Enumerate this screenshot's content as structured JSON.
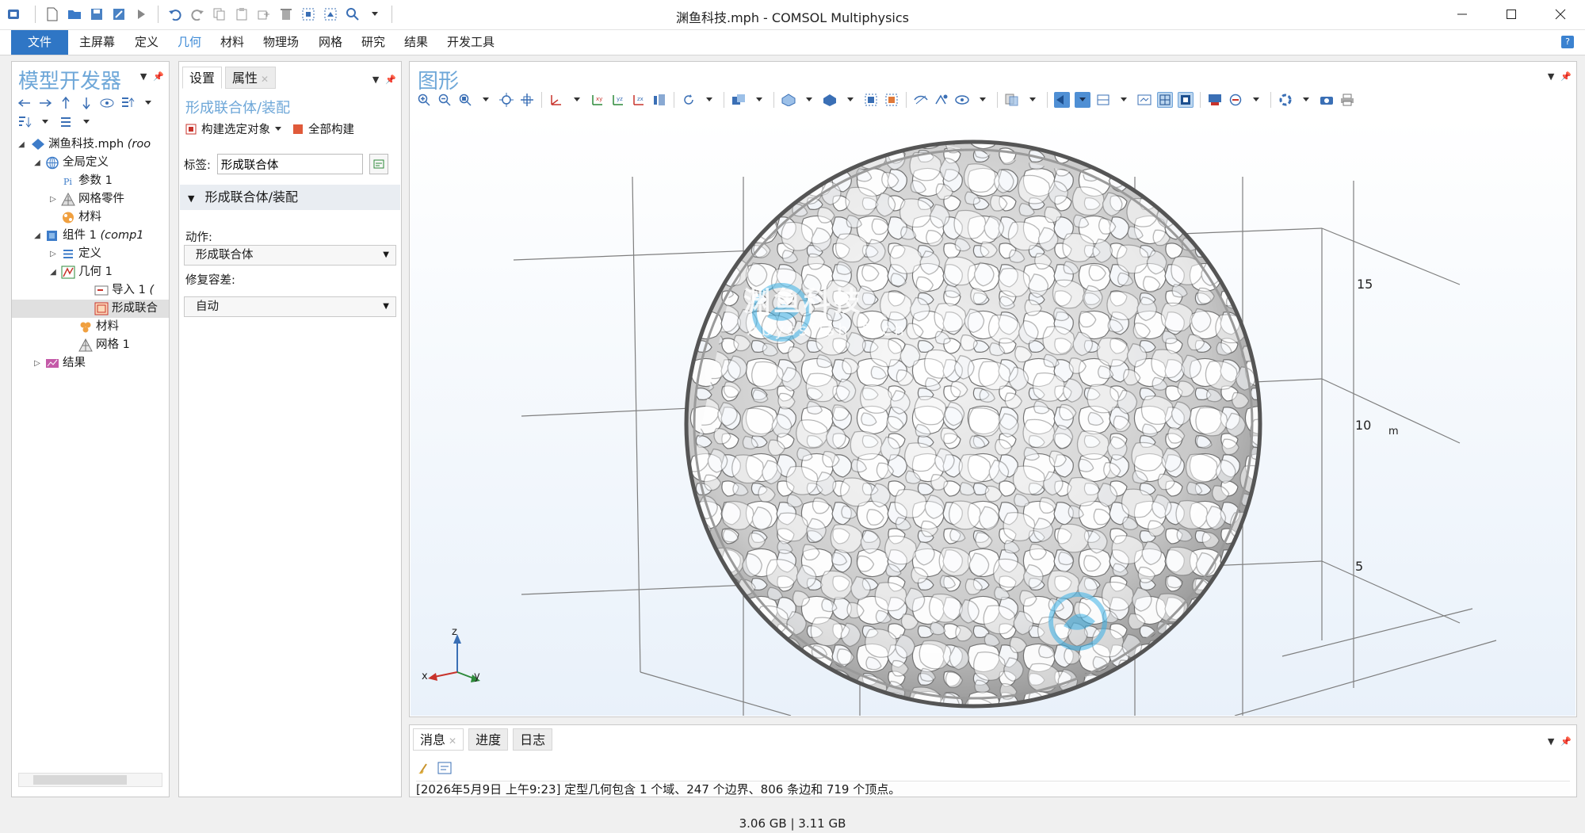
{
  "window": {
    "title": "渊鱼科技.mph - COMSOL Multiphysics"
  },
  "ribbon": {
    "tabs": [
      "文件",
      "主屏幕",
      "定义",
      "几何",
      "材料",
      "物理场",
      "网格",
      "研究",
      "结果",
      "开发工具"
    ],
    "active_tab": "几何",
    "help": "?"
  },
  "model_builder": {
    "title": "模型开发器",
    "tree": [
      {
        "label": "渊鱼科技.mph",
        "suffix": "(roo",
        "icon": "mph-file-icon"
      },
      {
        "label": "全局定义",
        "icon": "globe-icon"
      },
      {
        "label": "参数 1",
        "icon": "parameter-icon"
      },
      {
        "label": "网格零件",
        "icon": "mesh-part-icon"
      },
      {
        "label": "材料",
        "icon": "material-icon"
      },
      {
        "label": "组件 1",
        "suffix": "(comp1",
        "icon": "component-icon"
      },
      {
        "label": "定义",
        "icon": "definitions-icon"
      },
      {
        "label": "几何 1",
        "icon": "geometry-icon"
      },
      {
        "label": "导入 1",
        "suffix": "(",
        "icon": "import-icon"
      },
      {
        "label": "形成联合",
        "icon": "form-union-icon"
      },
      {
        "label": "材料",
        "icon": "material-icon"
      },
      {
        "label": "网格 1",
        "icon": "mesh-icon"
      },
      {
        "label": "结果",
        "icon": "results-icon"
      }
    ]
  },
  "settings": {
    "tabs": [
      "设置",
      "属性"
    ],
    "heading": "形成联合体/装配",
    "build_selected": "构建选定对象",
    "build_all": "全部构建",
    "label_caption": "标签:",
    "label_value": "形成联合体",
    "section_title": "形成联合体/装配",
    "action_caption": "动作:",
    "action_value": "形成联合体",
    "repair_caption": "修复容差:",
    "repair_value": "自动"
  },
  "graphics": {
    "title": "图形",
    "axis_ticks": [
      "15",
      "10",
      "5"
    ],
    "unit": "m",
    "triad": {
      "z": "z",
      "x": "x",
      "y": "y"
    },
    "watermark_cn": "渊鱼科技",
    "watermark_en": "Abyssfish Tech"
  },
  "messages": {
    "tabs": [
      "消息",
      "进度",
      "日志"
    ],
    "text": "[2026年5月9日 上午9:23] 定型几何包含 1 个域、247 个边界、806 条边和 719 个顶点。"
  },
  "status": {
    "memory": "3.06 GB | 3.11 GB"
  },
  "colors": {
    "accent": "#2f76c5",
    "panel_title": "#6ea7d8",
    "viewport_bg": "#e9f1fa"
  }
}
